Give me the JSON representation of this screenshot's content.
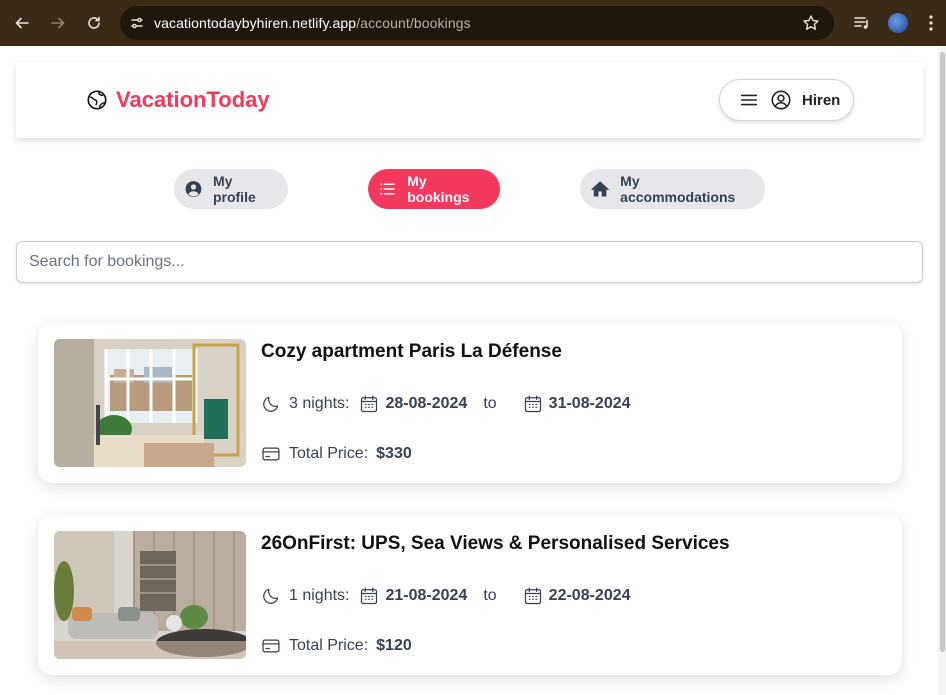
{
  "browser": {
    "url_host": "vacationtodaybyhiren.netlify.app",
    "url_path": "/account/bookings"
  },
  "header": {
    "logo_text": "VacationToday",
    "user_name": "Hiren"
  },
  "tabs": [
    {
      "label": "My profile",
      "active": false
    },
    {
      "label": "My bookings",
      "active": true
    },
    {
      "label": "My accommodations",
      "active": false
    }
  ],
  "search": {
    "placeholder": "Search for bookings...",
    "value": ""
  },
  "bookings": [
    {
      "title": "Cozy apartment Paris La Défense",
      "nights_label": "3 nights:",
      "check_in": "28-08-2024",
      "to_label": "to",
      "check_out": "31-08-2024",
      "price_label": "Total Price:",
      "price": "$330"
    },
    {
      "title": "26OnFirst: UPS, Sea Views & Personalised Services",
      "nights_label": "1 nights:",
      "check_in": "21-08-2024",
      "to_label": "to",
      "check_out": "22-08-2024",
      "price_label": "Total Price:",
      "price": "$120"
    }
  ],
  "colors": {
    "brand": "#f5385d",
    "chrome_bg": "#3b2b16",
    "tab_inactive": "#e5e7eb"
  }
}
